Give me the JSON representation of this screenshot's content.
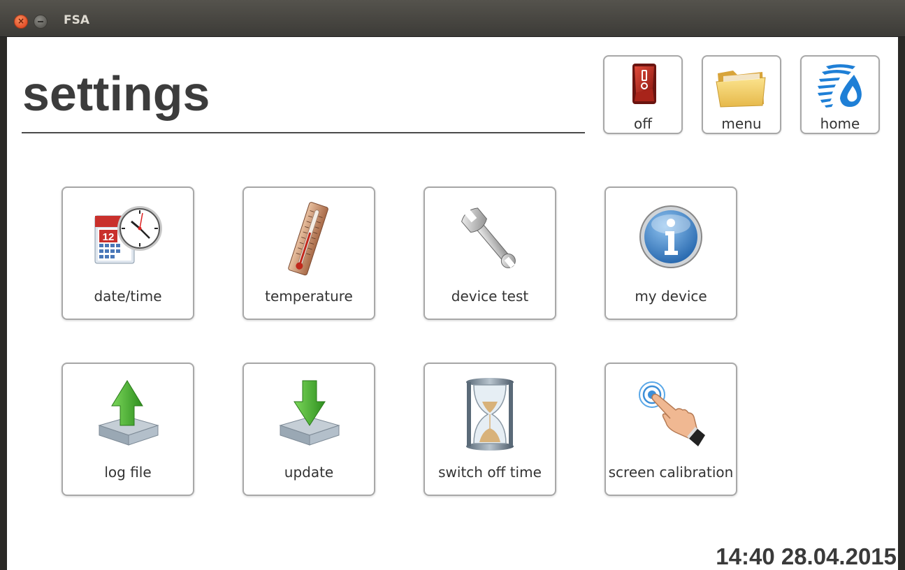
{
  "window": {
    "title": "FSA",
    "close_glyph": "×"
  },
  "header": {
    "page_title": "settings"
  },
  "top_buttons": [
    {
      "label": "off",
      "icon": "power-switch-icon"
    },
    {
      "label": "menu",
      "icon": "folder-icon"
    },
    {
      "label": "home",
      "icon": "brand-logo-icon"
    }
  ],
  "tiles": [
    {
      "label": "date/time",
      "icon": "calendar-clock-icon"
    },
    {
      "label": "temperature",
      "icon": "thermometer-icon"
    },
    {
      "label": "device test",
      "icon": "wrench-icon"
    },
    {
      "label": "my device",
      "icon": "info-icon"
    },
    {
      "label": "log file",
      "icon": "upload-tray-icon"
    },
    {
      "label": "update",
      "icon": "download-tray-icon"
    },
    {
      "label": "switch off time",
      "icon": "hourglass-icon"
    },
    {
      "label": "screen calibration",
      "icon": "touch-hand-icon"
    }
  ],
  "calendar_day": "12",
  "status": {
    "datetime": "14:40 28.04.2015"
  },
  "colors": {
    "titlebar": "#3c3b37",
    "text": "#3c3c3c",
    "tile_border": "#a8a8a8",
    "brand_blue": "#1e7fd6"
  }
}
